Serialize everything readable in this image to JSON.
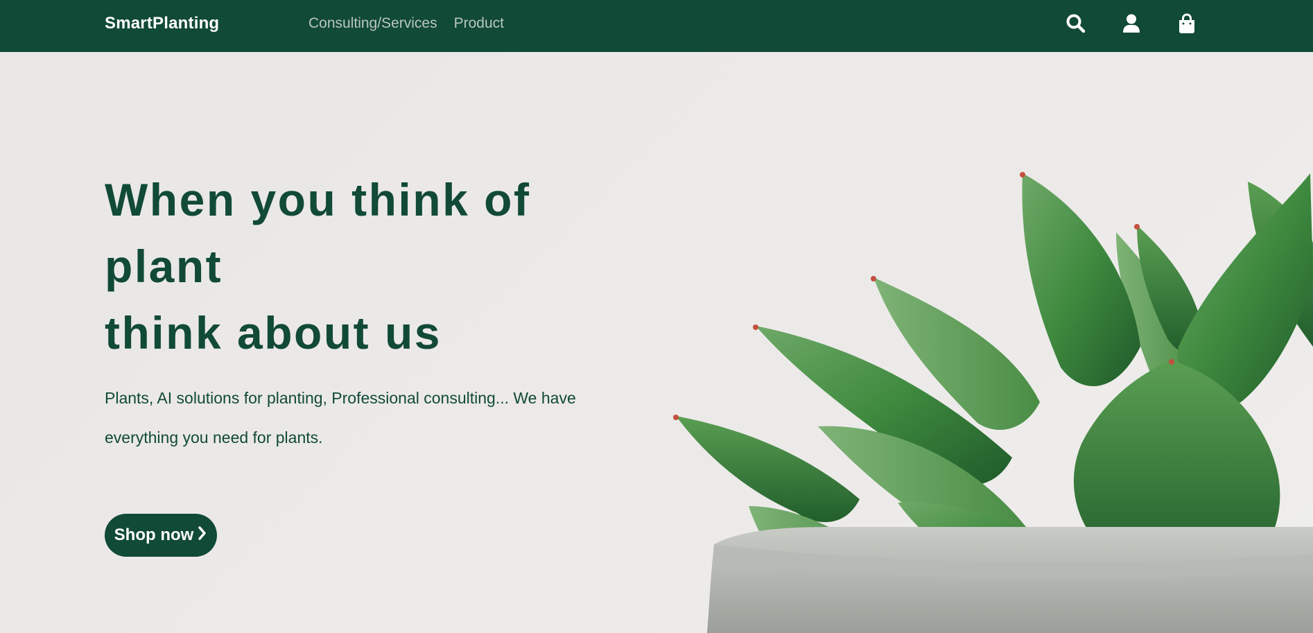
{
  "navbar": {
    "brand": "SmartPlanting",
    "links": [
      {
        "label": "Consulting/Services"
      },
      {
        "label": "Product"
      }
    ],
    "icons": [
      "search-icon",
      "user-icon",
      "shopping-bag-icon"
    ]
  },
  "hero": {
    "title_lines": [
      "When you think of",
      "plant",
      "think about us"
    ],
    "description": "Plants, AI solutions for planting, Professional consulting... We have everything you need for plants.",
    "cta_label": "Shop now",
    "cta_icon": "chevron-right-icon"
  },
  "colors": {
    "primary": "#114a36",
    "nav_link": "#b9c6bf",
    "background": "#ebe9e7",
    "white": "#ffffff"
  }
}
